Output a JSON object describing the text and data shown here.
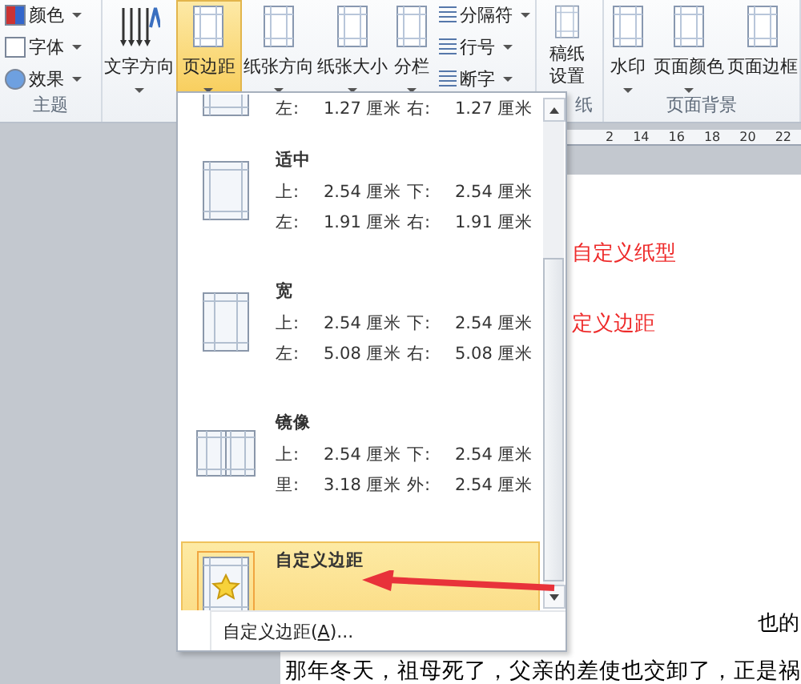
{
  "ribbon": {
    "groups": [
      {
        "caption": "主题",
        "items": [
          {
            "kind": "stack",
            "commands": [
              {
                "label": "颜色",
                "dropdown": true
              },
              {
                "label": "字体",
                "dropdown": true
              },
              {
                "label": "效果",
                "dropdown": true
              }
            ]
          }
        ]
      },
      {
        "items": [
          {
            "kind": "large",
            "label": "文字方向",
            "dropdown": true,
            "selected": false
          },
          {
            "kind": "large",
            "label": "页边距",
            "dropdown": true,
            "selected": true
          },
          {
            "kind": "large",
            "label": "纸张方向",
            "dropdown": true,
            "selected": false
          },
          {
            "kind": "large",
            "label": "纸张大小",
            "dropdown": true,
            "selected": false
          },
          {
            "kind": "large",
            "label": "分栏",
            "dropdown": true,
            "selected": false
          },
          {
            "kind": "stack",
            "commands": [
              {
                "label": "分隔符",
                "dropdown": true
              },
              {
                "label": "行号",
                "dropdown": true
              },
              {
                "label": "断字",
                "dropdown": true
              }
            ]
          }
        ]
      },
      {
        "caption": "纸",
        "items": [
          {
            "kind": "large",
            "label": "稿纸设置",
            "dropdown": false,
            "selected": false
          }
        ]
      },
      {
        "caption": "页面背景",
        "items": [
          {
            "kind": "large",
            "label": "水印",
            "dropdown": true,
            "selected": false
          },
          {
            "kind": "large",
            "label": "页面颜色",
            "dropdown": true,
            "selected": false
          },
          {
            "kind": "large",
            "label": "页面边框",
            "dropdown": false,
            "selected": false
          }
        ]
      }
    ]
  },
  "ruler_labels": [
    "2",
    "14",
    "16",
    "18",
    "20",
    "22"
  ],
  "document": {
    "lines": [
      {
        "text": "自定义纸型",
        "kind": "red"
      },
      {
        "text": "定义边距",
        "kind": "red"
      },
      {
        "text": "也的",
        "kind": "right"
      },
      {
        "text": "那年冬天，祖母死了，父亲的差使也交卸了，正是祸",
        "kind": "full"
      }
    ]
  },
  "margins_menu": {
    "presets": [
      {
        "kind": "partial",
        "highlighted": false,
        "rows": [
          {
            "l1": "左:",
            "v1": "1.27 厘米",
            "l2": "右:",
            "v2": "1.27 厘米"
          }
        ]
      },
      {
        "kind": "moderate",
        "name": "适中",
        "highlighted": false,
        "rows": [
          {
            "l1": "上:",
            "v1": "2.54 厘米",
            "l2": "下:",
            "v2": "2.54 厘米"
          },
          {
            "l1": "左:",
            "v1": "1.91 厘米",
            "l2": "右:",
            "v2": "1.91 厘米"
          }
        ]
      },
      {
        "kind": "wide",
        "name": "宽",
        "highlighted": false,
        "rows": [
          {
            "l1": "上:",
            "v1": "2.54 厘米",
            "l2": "下:",
            "v2": "2.54 厘米"
          },
          {
            "l1": "左:",
            "v1": "5.08 厘米",
            "l2": "右:",
            "v2": "5.08 厘米"
          }
        ]
      },
      {
        "kind": "mirrored",
        "name": "镜像",
        "highlighted": false,
        "rows": [
          {
            "l1": "上:",
            "v1": "2.54 厘米",
            "l2": "下:",
            "v2": "2.54 厘米"
          },
          {
            "l1": "里:",
            "v1": "3.18 厘米",
            "l2": "外:",
            "v2": "2.54 厘米"
          }
        ]
      },
      {
        "kind": "custom",
        "name": "自定义边距",
        "highlighted": true
      }
    ],
    "footer": {
      "before": "自定义边距(",
      "access_key": "A",
      "after": ")..."
    }
  }
}
